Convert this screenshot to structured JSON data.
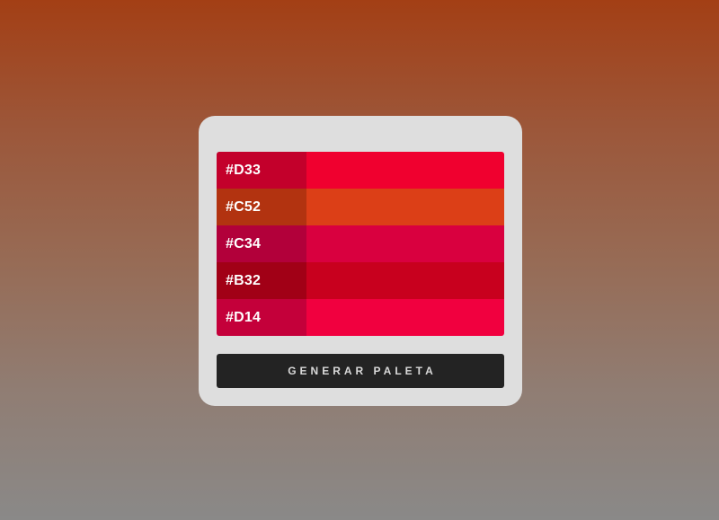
{
  "palette": {
    "swatches": [
      {
        "code": "#D33",
        "dark": "#c3002b",
        "color": "#f0002f"
      },
      {
        "code": "#C52",
        "dark": "#b23310",
        "color": "#dc3f17"
      },
      {
        "code": "#C34",
        "dark": "#b2003a",
        "color": "#d9003f"
      },
      {
        "code": "#B32",
        "dark": "#a10016",
        "color": "#c8001e"
      },
      {
        "code": "#D14",
        "dark": "#c4003a",
        "color": "#f1003f"
      }
    ]
  },
  "actions": {
    "generate_label": "GENERAR PALETA"
  },
  "colors": {
    "card": "#dedede",
    "button": "#232323",
    "button_text": "#d9d9d9"
  }
}
